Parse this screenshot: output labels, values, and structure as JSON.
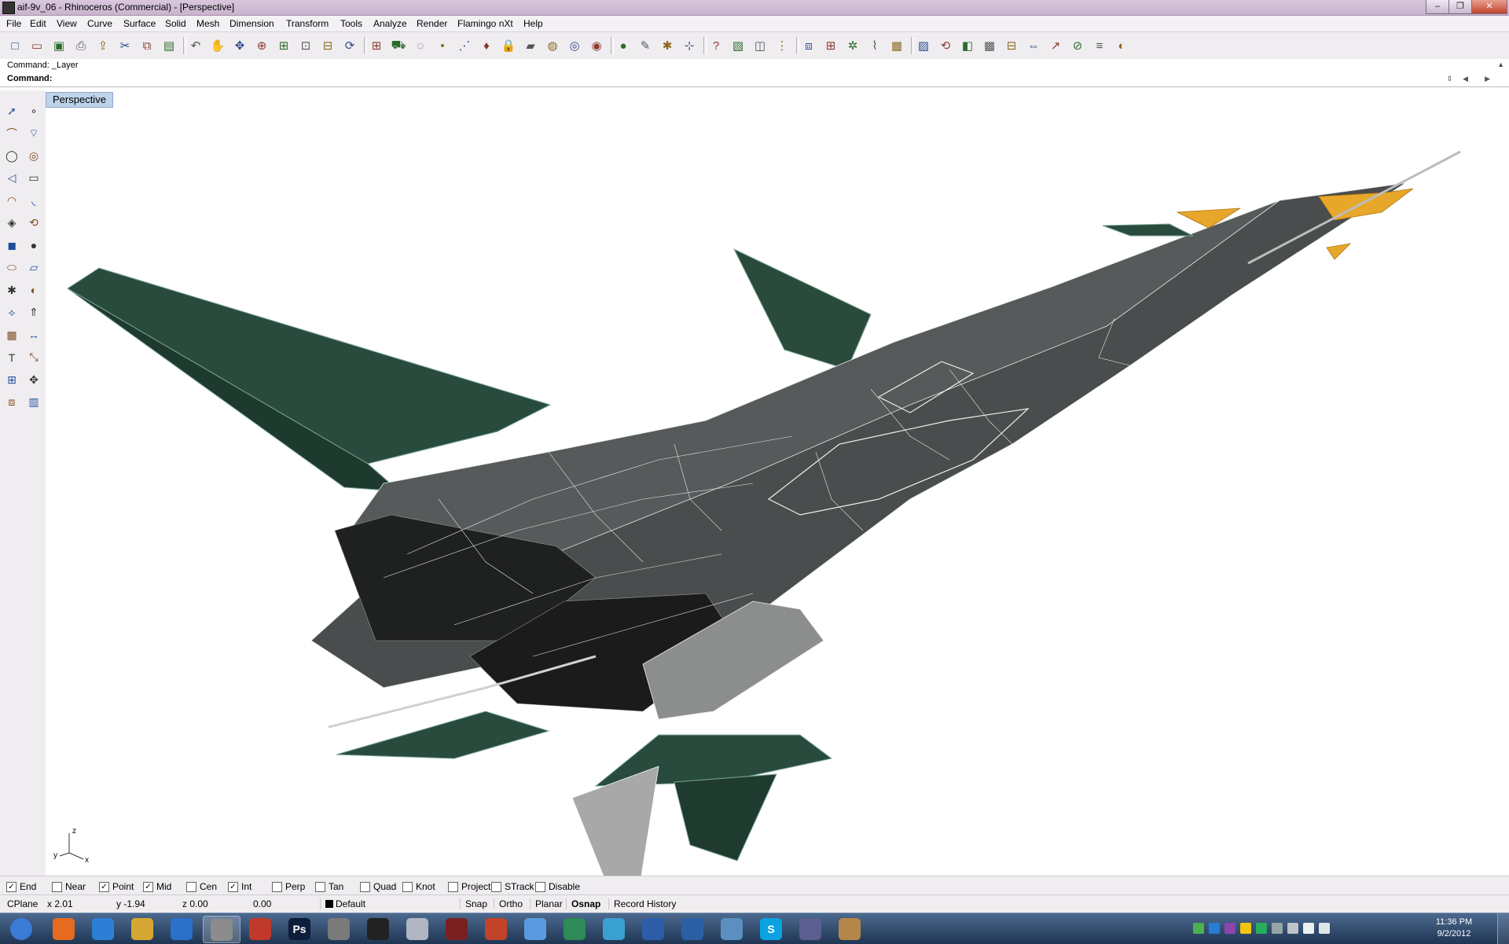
{
  "window": {
    "title": "aif-9v_06 - Rhinoceros (Commercial) - [Perspective]",
    "controls": [
      "–",
      "❐",
      "✕"
    ]
  },
  "menu": [
    "File",
    "Edit",
    "View",
    "Curve",
    "Surface",
    "Solid",
    "Mesh",
    "Dimension",
    "Transform",
    "Tools",
    "Analyze",
    "Render",
    "Flamingo nXt",
    "Help"
  ],
  "toolbar_icons": [
    "new-icon",
    "open-icon",
    "save-icon",
    "print-icon",
    "import-icon",
    "cut-icon",
    "copy-icon",
    "paste-icon",
    "undo-icon",
    "pan-icon",
    "move-view-icon",
    "zoom-dynamic-icon",
    "zoom-window-icon",
    "zoom-extents-icon",
    "zoom-selected-icon",
    "rotate-view-icon",
    "four-viewports-icon",
    "car-icon",
    "render-icon",
    "point-icon",
    "snap-icon",
    "light-icon",
    "lock-icon",
    "layer-icon",
    "color-icon",
    "wireframe-icon",
    "shaded-icon",
    "render-sphere-icon",
    "pencil-icon",
    "settings-icon",
    "grid-icon",
    "help-icon",
    "box-icon",
    "boolean-icon",
    "split-icon",
    "clone-icon",
    "array-icon",
    "gumball-icon",
    "curve-tool-icon",
    "mesh-grid-icon",
    "image-icon",
    "rotate-icon",
    "surface-icon",
    "hatch-icon",
    "table-icon",
    "mirror-icon",
    "extend-icon",
    "clip-icon",
    "script-icon",
    "camera-icon"
  ],
  "command": {
    "history": "Command: _Layer",
    "prompt_label": "Command:",
    "value": ""
  },
  "side_icons": [
    "select-icon",
    "point-icon",
    "polyline-icon",
    "curve-icon",
    "circle-icon",
    "ellipse-icon",
    "polygon-icon",
    "rectangle-icon",
    "arc-icon",
    "fillet-icon",
    "surface-pt-icon",
    "revolve-icon",
    "box-icon",
    "sphere-icon",
    "cylinder-icon",
    "plane-icon",
    "gear-icon",
    "boolean-icon",
    "loft-icon",
    "extrude-icon",
    "mesh-icon",
    "dim-icon",
    "text-icon",
    "scale-icon",
    "array-icon",
    "transform-icon",
    "render-icon",
    "ruler-icon"
  ],
  "viewport": {
    "name": "Perspective"
  },
  "axes": {
    "z": "z",
    "y": "y",
    "x": "x"
  },
  "model_colors": {
    "dark": "#2a2b2b",
    "mid": "#4a4d4d",
    "green": "#294b3d",
    "gray": "#a8a8a8",
    "yellow": "#e7a72a",
    "wire": "#e9ecec"
  },
  "osnaps": [
    {
      "label": "End",
      "checked": true
    },
    {
      "label": "Near",
      "checked": false
    },
    {
      "label": "Point",
      "checked": true
    },
    {
      "label": "Mid",
      "checked": true
    },
    {
      "label": "Cen",
      "checked": false
    },
    {
      "label": "Int",
      "checked": true
    },
    {
      "label": "Perp",
      "checked": false
    },
    {
      "label": "Tan",
      "checked": false
    },
    {
      "label": "Quad",
      "checked": false
    },
    {
      "label": "Knot",
      "checked": false
    },
    {
      "label": "Project",
      "checked": false
    },
    {
      "label": "STrack",
      "checked": false
    },
    {
      "label": "Disable",
      "checked": false
    }
  ],
  "status": {
    "cplane": "CPlane",
    "x": "x 2.01",
    "y": "y -1.94",
    "z": "z 0.00",
    "d": "0.00",
    "layer": "Default",
    "toggles": [
      "Snap",
      "Ortho",
      "Planar",
      "Osnap",
      "Record History"
    ]
  },
  "taskbar": {
    "apps": [
      "start-icon",
      "firefox-icon",
      "ie-icon",
      "explorer-icon",
      "media-icon",
      "rhino-icon",
      "sketchup-icon",
      "Ps",
      "character-icon",
      "app-s-icon",
      "hand-icon",
      "game-icon",
      "powerpoint-icon",
      "bird-icon",
      "maps-icon",
      "chrome-icon",
      "ring-icon",
      "note-icon",
      "calculator-icon",
      "S",
      "video-icon",
      "archive-icon"
    ],
    "time": "11:36 PM",
    "date": "9/2/2012"
  }
}
